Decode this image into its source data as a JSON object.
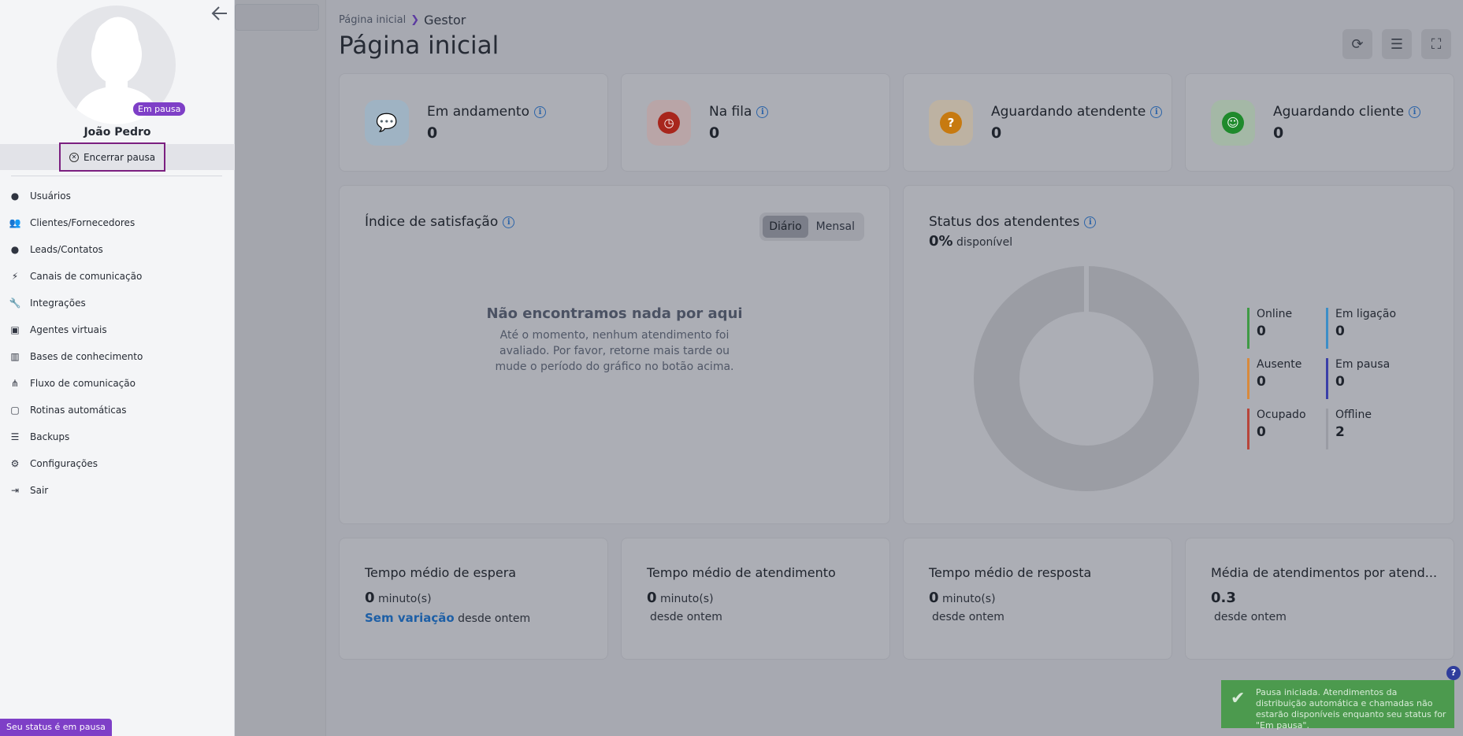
{
  "breadcrumb": {
    "home": "Página inicial",
    "current": "Gestor"
  },
  "page_title": "Página inicial",
  "stats": [
    {
      "label": "Em andamento",
      "value": "0",
      "color": "#4a90c8"
    },
    {
      "label": "Na fila",
      "value": "0",
      "color": "#c0392b"
    },
    {
      "label": "Aguardando atendente",
      "value": "0",
      "color": "#d68a1a"
    },
    {
      "label": "Aguardando cliente",
      "value": "0",
      "color": "#2e9b3a"
    }
  ],
  "satisfaction": {
    "title": "Índice de satisfação",
    "toggle": {
      "daily": "Diário",
      "monthly": "Mensal",
      "selected": "Diário"
    },
    "empty_title": "Não encontramos nada por aqui",
    "empty_text": "Até o momento, nenhum atendimento foi avaliado. Por favor, retorne mais tarde ou mude o período do gráfico no botão acima."
  },
  "agents_status": {
    "title": "Status dos atendentes",
    "percent": "0%",
    "percent_label": "disponível",
    "legend": [
      {
        "label": "Online",
        "value": "0",
        "color": "#3f9a45"
      },
      {
        "label": "Em ligação",
        "value": "0",
        "color": "#3c8ec7"
      },
      {
        "label": "Ausente",
        "value": "0",
        "color": "#d98a3c"
      },
      {
        "label": "Em pausa",
        "value": "0",
        "color": "#3a3fa8"
      },
      {
        "label": "Ocupado",
        "value": "0",
        "color": "#b8453a"
      },
      {
        "label": "Offline",
        "value": "2",
        "color": "#9a9ca4"
      }
    ]
  },
  "metrics": [
    {
      "title": "Tempo médio de espera",
      "value": "0",
      "unit": "minuto(s)",
      "variation": "Sem variação",
      "since": "desde ontem"
    },
    {
      "title": "Tempo médio de atendimento",
      "value": "0",
      "unit": "minuto(s)",
      "variation": "",
      "since": "desde ontem"
    },
    {
      "title": "Tempo médio de resposta",
      "value": "0",
      "unit": "minuto(s)",
      "variation": "",
      "since": "desde ontem"
    },
    {
      "title": "Média de atendimentos por atend...",
      "value": "0.3",
      "unit": "",
      "variation": "",
      "since": "desde ontem"
    }
  ],
  "drawer": {
    "status_pill": "Em pausa",
    "user_name": "João Pedro",
    "end_pause": "Encerrar pausa",
    "nav": [
      {
        "label": "Usuários",
        "icon": "user-icon"
      },
      {
        "label": "Clientes/Fornecedores",
        "icon": "users-icon"
      },
      {
        "label": "Leads/Contatos",
        "icon": "contacts-icon"
      },
      {
        "label": "Canais de comunicação",
        "icon": "plug-icon"
      },
      {
        "label": "Integrações",
        "icon": "wrench-icon"
      },
      {
        "label": "Agentes virtuais",
        "icon": "robot-icon"
      },
      {
        "label": "Bases de conhecimento",
        "icon": "books-icon"
      },
      {
        "label": "Fluxo de comunicação",
        "icon": "flow-icon"
      },
      {
        "label": "Rotinas automáticas",
        "icon": "calendar-icon"
      },
      {
        "label": "Backups",
        "icon": "database-icon"
      },
      {
        "label": "Configurações",
        "icon": "gears-icon"
      },
      {
        "label": "Sair",
        "icon": "logout-icon"
      }
    ],
    "status_footer": "Seu status é em pausa"
  },
  "toast": {
    "message": "Pausa iniciada. Atendimentos da distribuição automática e chamadas não estarão disponíveis enquanto seu status for \"Em pausa\"."
  },
  "help": "?"
}
